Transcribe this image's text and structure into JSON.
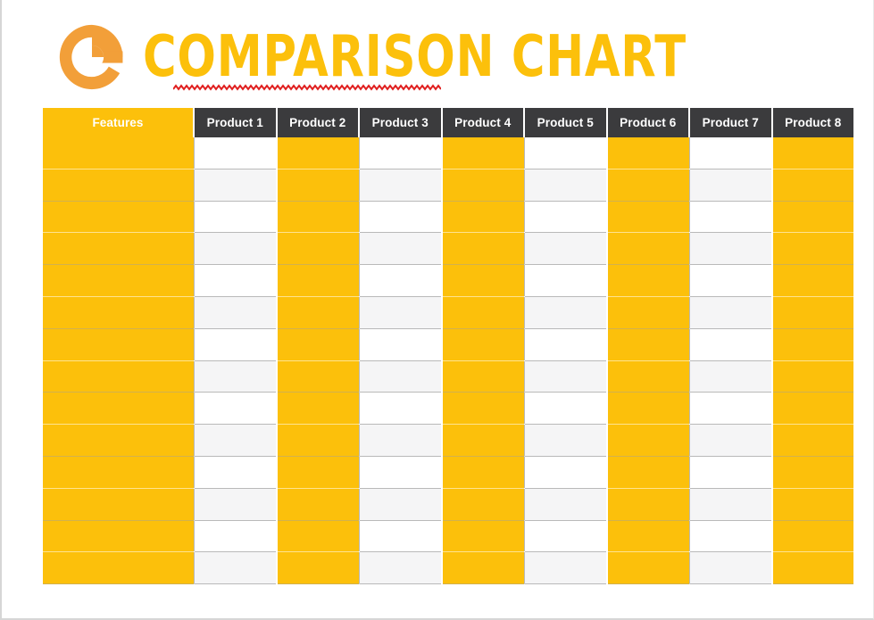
{
  "page": {
    "background_color": "#ffffff",
    "accent_yellow": "#fcc00b",
    "logo_orange": "#f29f39",
    "header_dark": "#3b3b3d",
    "squiggle_color": "#e02020",
    "row_alt_color": "#f5f5f6"
  },
  "header": {
    "logo_icon": "letter-e-circle-logo",
    "title": "COMPARISON CHART",
    "underline_style": "red-squiggle"
  },
  "table": {
    "columns": [
      {
        "label": "Features",
        "type": "feature",
        "style": "yellow"
      },
      {
        "label": "Product 1",
        "type": "product",
        "style": "plain"
      },
      {
        "label": "Product 2",
        "type": "product",
        "style": "yellow"
      },
      {
        "label": "Product 3",
        "type": "product",
        "style": "plain"
      },
      {
        "label": "Product 4",
        "type": "product",
        "style": "yellow"
      },
      {
        "label": "Product 5",
        "type": "product",
        "style": "plain"
      },
      {
        "label": "Product 6",
        "type": "product",
        "style": "yellow"
      },
      {
        "label": "Product 7",
        "type": "product",
        "style": "plain"
      },
      {
        "label": "Product 8",
        "type": "product",
        "style": "yellow"
      }
    ],
    "row_count": 14,
    "rows": [
      {
        "feature": "",
        "values": [
          "",
          "",
          "",
          "",
          "",
          "",
          "",
          ""
        ]
      },
      {
        "feature": "",
        "values": [
          "",
          "",
          "",
          "",
          "",
          "",
          "",
          ""
        ]
      },
      {
        "feature": "",
        "values": [
          "",
          "",
          "",
          "",
          "",
          "",
          "",
          ""
        ]
      },
      {
        "feature": "",
        "values": [
          "",
          "",
          "",
          "",
          "",
          "",
          "",
          ""
        ]
      },
      {
        "feature": "",
        "values": [
          "",
          "",
          "",
          "",
          "",
          "",
          "",
          ""
        ]
      },
      {
        "feature": "",
        "values": [
          "",
          "",
          "",
          "",
          "",
          "",
          "",
          ""
        ]
      },
      {
        "feature": "",
        "values": [
          "",
          "",
          "",
          "",
          "",
          "",
          "",
          ""
        ]
      },
      {
        "feature": "",
        "values": [
          "",
          "",
          "",
          "",
          "",
          "",
          "",
          ""
        ]
      },
      {
        "feature": "",
        "values": [
          "",
          "",
          "",
          "",
          "",
          "",
          "",
          ""
        ]
      },
      {
        "feature": "",
        "values": [
          "",
          "",
          "",
          "",
          "",
          "",
          "",
          ""
        ]
      },
      {
        "feature": "",
        "values": [
          "",
          "",
          "",
          "",
          "",
          "",
          "",
          ""
        ]
      },
      {
        "feature": "",
        "values": [
          "",
          "",
          "",
          "",
          "",
          "",
          "",
          ""
        ]
      },
      {
        "feature": "",
        "values": [
          "",
          "",
          "",
          "",
          "",
          "",
          "",
          ""
        ]
      },
      {
        "feature": "",
        "values": [
          "",
          "",
          "",
          "",
          "",
          "",
          "",
          ""
        ]
      }
    ]
  }
}
